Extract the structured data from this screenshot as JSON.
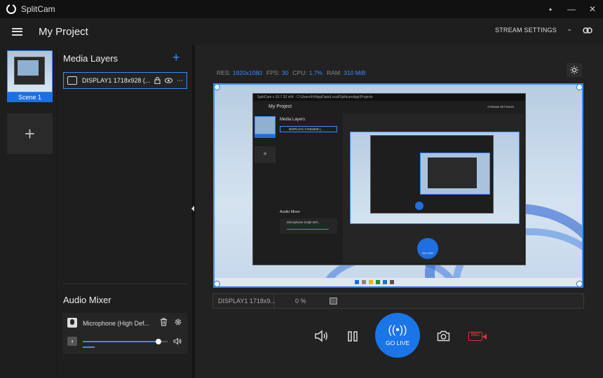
{
  "app": {
    "name": "SplitCam"
  },
  "window_controls": {
    "pin": "⬩",
    "minimize": "—",
    "close": "✕"
  },
  "header": {
    "project_title": "My Project",
    "stream_settings_label": "STREAM SETTINGS",
    "chevron": "⌄"
  },
  "scenes": {
    "items": [
      {
        "label": "Scene 1",
        "selected": true
      }
    ],
    "add_label": "+"
  },
  "media_layers": {
    "title": "Media Layers",
    "add_label": "+",
    "items": [
      {
        "name": "DISPLAY1 1718x928 (...",
        "lock_icon": "lock-icon",
        "eye_icon": "eye-icon",
        "more": "⋯"
      }
    ]
  },
  "audio_mixer": {
    "title": "Audio Mixer",
    "items": [
      {
        "name": "Microphone (High Def...",
        "volume_fraction": 0.89
      }
    ]
  },
  "stats": {
    "res_label": "RES:",
    "res_value": "1920x1080",
    "fps_label": "FPS:",
    "fps_value": "30",
    "cpu_label": "CPU:",
    "cpu_value": "1.7%",
    "ram_label": "RAM:",
    "ram_value": "310 MiB"
  },
  "inner_preview": {
    "title_text": "SplitCam v 10.7.32 x64 - C:\\Users\\Hi\\AppData\\Local\\SplitcamApp\\Projects",
    "project_title": "My Project",
    "stream_settings_label": "STREAM SETTINGS",
    "media_layers_title": "Media Layers",
    "layer_name": "DISPLAY1 1718x928 (...",
    "audio_mixer_title": "Audio Mixer",
    "mic_name": "Microphone (High Def...",
    "add_label": "+",
    "go_live": "GO LIVE"
  },
  "source_bar": {
    "name": "DISPLAY1 1718x9...",
    "percent": "0 %"
  },
  "controls": {
    "go_live_label": "GO LIVE",
    "go_live_icon": "((•))",
    "record_label": "REC"
  },
  "colors": {
    "accent": "#1a75e8",
    "record": "#e0303a",
    "background": "#1b1b1b"
  }
}
